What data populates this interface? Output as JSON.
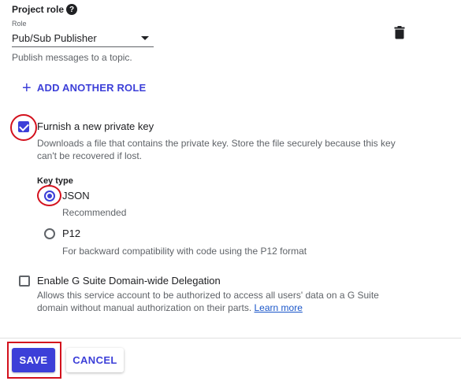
{
  "project_role": {
    "heading": "Project role",
    "role_label": "Role",
    "role_value": "Pub/Sub Publisher",
    "role_description": "Publish messages to a topic."
  },
  "add_role_label": "ADD ANOTHER ROLE",
  "private_key": {
    "title": "Furnish a new private key",
    "checked": true,
    "description": "Downloads a file that contains the private key. Store the file securely because this key can't be recovered if lost."
  },
  "key_type": {
    "label": "Key type",
    "options": [
      {
        "label": "JSON",
        "description": "Recommended",
        "selected": true
      },
      {
        "label": "P12",
        "description": "For backward compatibility with code using the P12 format",
        "selected": false
      }
    ]
  },
  "gsuite": {
    "title": "Enable G Suite Domain-wide Delegation",
    "checked": false,
    "description": "Allows this service account to be authorized to access all users' data on a G Suite domain without manual authorization on their parts.",
    "link_text": "Learn more"
  },
  "buttons": {
    "save": "SAVE",
    "cancel": "CANCEL"
  },
  "colors": {
    "accent": "#3c3fd8",
    "highlight": "#d3111d"
  }
}
